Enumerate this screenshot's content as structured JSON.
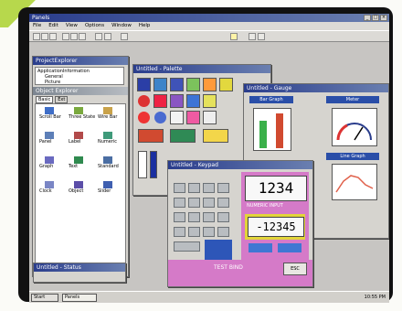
{
  "app": {
    "title": "Panels",
    "menu": [
      "File",
      "Edit",
      "View",
      "Options",
      "Window",
      "Help"
    ]
  },
  "explorer": {
    "title": "ProjectExplorer",
    "tree": [
      "ApplicationInformation",
      "General",
      "Picture"
    ],
    "objects_title": "Object Explorer",
    "tabs": [
      "Basic",
      "Ext"
    ],
    "objects": [
      "Scroll Bar",
      "Three State",
      "Wire Bar",
      "Panel",
      "Label",
      "Numeric",
      "Graph",
      "Text",
      "Standard",
      "Clock",
      "Object",
      "Slider"
    ]
  },
  "palette_window": {
    "title": "Untitled - Palette"
  },
  "gauge_window": {
    "title": "Untitled - Gauge",
    "bar_graph_label": "Bar Graph",
    "meter_label": "Meter",
    "line_graph_label": "Line Graph"
  },
  "keypad_window": {
    "title": "Untitled - Keypad",
    "display_value": "1234",
    "subtitle": "NUMERIC INPUT",
    "negative_value": "-12345",
    "footer": "TEST BIND",
    "ok_label": "ESC"
  },
  "status_window": {
    "title": "Untitled - Status"
  },
  "taskbar": {
    "start_label": "Start",
    "task_label": "Panels",
    "clock": "10:55 PM"
  },
  "colors": {
    "titlebar": "#2a3d8c",
    "pink": "#d57ac8",
    "yellow": "#e5d84a",
    "desktop": "#c7c5c2"
  }
}
